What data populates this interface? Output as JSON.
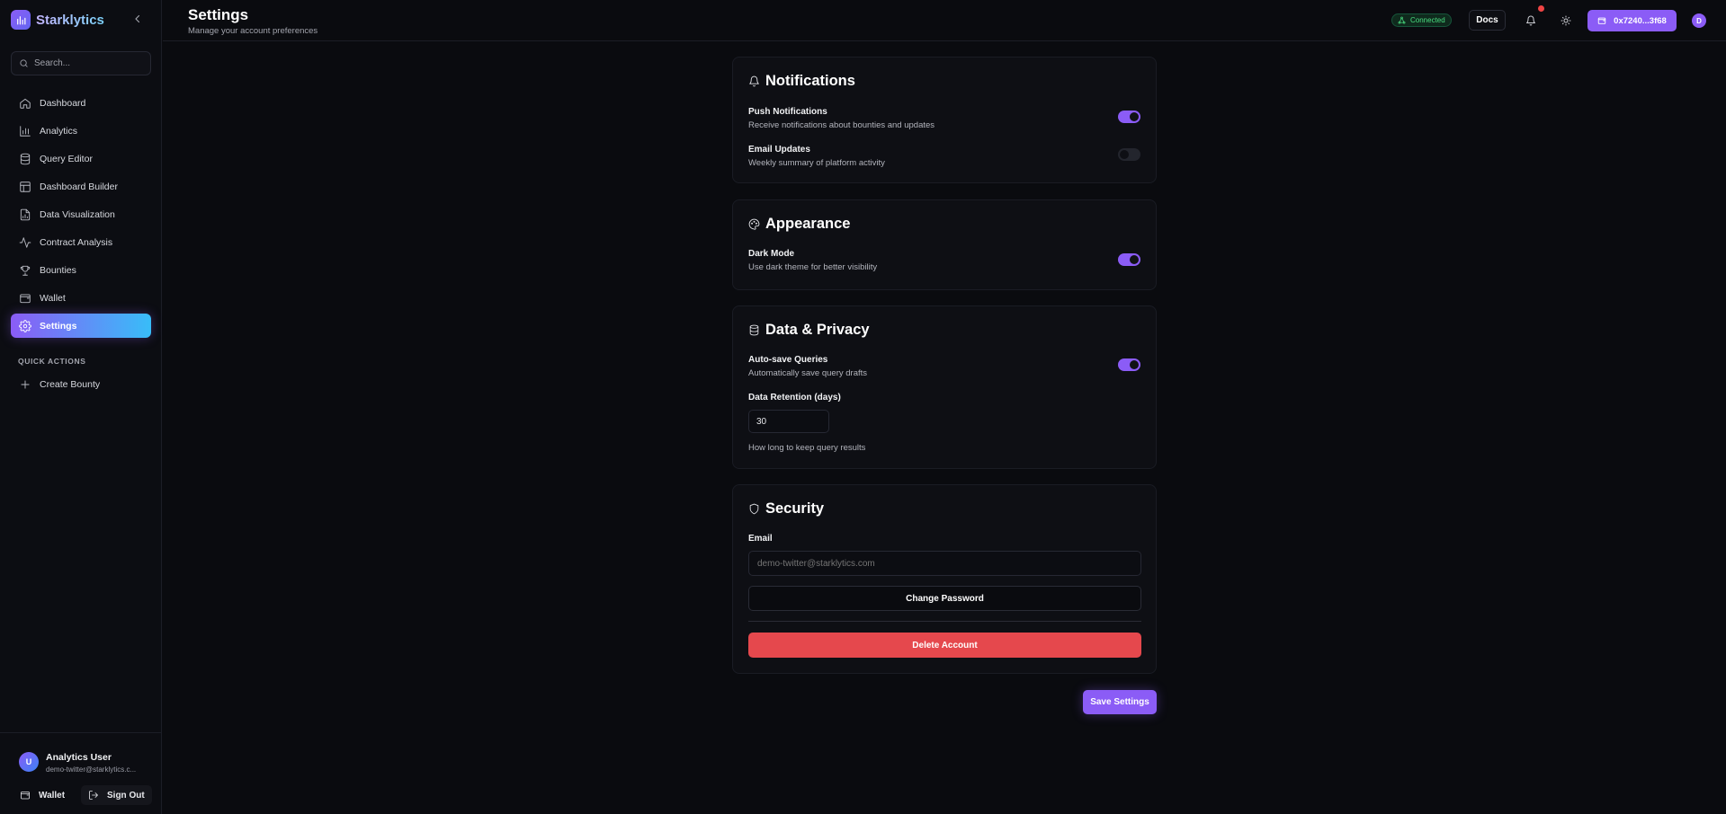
{
  "app": {
    "name": "Starklytics"
  },
  "sidebar": {
    "search_placeholder": "Search...",
    "items": [
      {
        "label": "Dashboard",
        "icon": "home-icon"
      },
      {
        "label": "Analytics",
        "icon": "bar-chart-icon"
      },
      {
        "label": "Query Editor",
        "icon": "database-icon"
      },
      {
        "label": "Dashboard Builder",
        "icon": "layout-icon"
      },
      {
        "label": "Data Visualization",
        "icon": "file-chart-icon"
      },
      {
        "label": "Contract Analysis",
        "icon": "activity-icon"
      },
      {
        "label": "Bounties",
        "icon": "trophy-icon"
      },
      {
        "label": "Wallet",
        "icon": "wallet-icon"
      },
      {
        "label": "Settings",
        "icon": "gear-icon",
        "active": true
      }
    ],
    "quick_actions_title": "QUICK ACTIONS",
    "quick_actions": [
      {
        "label": "Create Bounty",
        "icon": "plus-icon"
      }
    ],
    "user": {
      "initial": "U",
      "name": "Analytics User",
      "email": "demo-twitter@starklytics.c..."
    },
    "footer_wallet": "Wallet",
    "footer_signout": "Sign Out"
  },
  "header": {
    "title": "Settings",
    "subtitle": "Manage your account preferences",
    "status": "Connected",
    "docs": "Docs",
    "wallet_address": "0x7240...3f68",
    "avatar_initial": "D"
  },
  "notifications": {
    "title": "Notifications",
    "push": {
      "label": "Push Notifications",
      "desc": "Receive notifications about bounties and updates",
      "enabled": true
    },
    "email": {
      "label": "Email Updates",
      "desc": "Weekly summary of platform activity",
      "enabled": false
    }
  },
  "appearance": {
    "title": "Appearance",
    "dark_mode": {
      "label": "Dark Mode",
      "desc": "Use dark theme for better visibility",
      "enabled": true
    }
  },
  "privacy": {
    "title": "Data & Privacy",
    "autosave": {
      "label": "Auto-save Queries",
      "desc": "Automatically save query drafts",
      "enabled": true
    },
    "retention_label": "Data Retention (days)",
    "retention_value": "30",
    "retention_hint": "How long to keep query results"
  },
  "security": {
    "title": "Security",
    "email_label": "Email",
    "email_placeholder": "demo-twitter@starklytics.com",
    "change_password": "Change Password",
    "delete_account": "Delete Account"
  },
  "save_label": "Save Settings",
  "colors": {
    "accent": "#8b5cf6",
    "danger": "#e5484d",
    "success": "#4ade80",
    "background": "#0a0b0f"
  }
}
